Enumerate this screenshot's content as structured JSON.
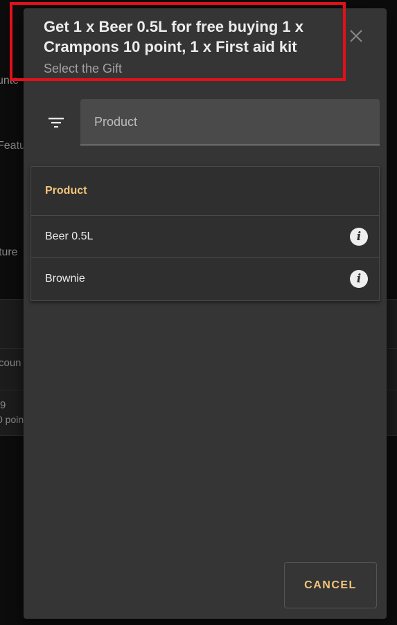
{
  "background": {
    "fragments": [
      "unte",
      "Featu",
      "ture",
      "coun",
      "9",
      "0 poin"
    ]
  },
  "dialog": {
    "title": "Get 1 x Beer 0.5L for free buying 1 x Crampons 10 point, 1 x First aid kit",
    "subtitle": "Select the Gift",
    "close_icon": "close-icon",
    "filter_icon": "filter-icon",
    "search": {
      "placeholder": "Product",
      "value": ""
    },
    "table": {
      "header": "Product",
      "rows": [
        {
          "label": "Beer 0.5L",
          "icon": "info-icon"
        },
        {
          "label": "Brownie",
          "icon": "info-icon"
        }
      ]
    },
    "cancel_label": "CANCEL"
  },
  "colors": {
    "accent": "#f3c57a",
    "highlight": "#e3101a",
    "dialog_bg": "#353535"
  }
}
